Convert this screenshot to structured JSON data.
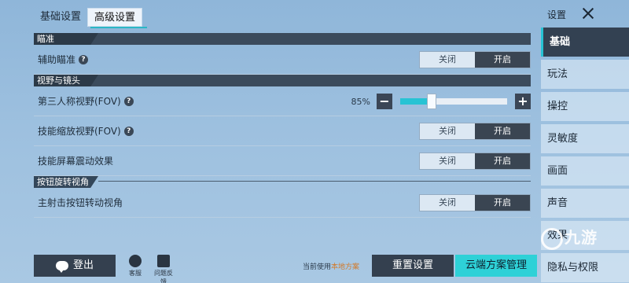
{
  "tabs": [
    {
      "label": "基础设置"
    },
    {
      "label": "高级设置"
    }
  ],
  "sections": {
    "aim": {
      "title": "瞄准"
    },
    "view": {
      "title": "视野与镜头"
    },
    "button_rotate": {
      "title": "按钮旋转视角"
    }
  },
  "rows": {
    "assist_aim": {
      "label": "辅助瞄准",
      "off": "关闭",
      "on": "开启"
    },
    "third_person_fov": {
      "label": "第三人称视野(FOV)",
      "percent": "85%",
      "value_fraction": 0.25
    },
    "skill_zoom_fov": {
      "label": "技能缩放视野(FOV)",
      "off": "关闭",
      "on": "开启"
    },
    "skill_shake": {
      "label": "技能屏幕震动效果",
      "off": "关闭",
      "on": "开启"
    },
    "fire_rotate": {
      "label": "主射击按钮转动视角",
      "off": "关闭",
      "on": "开启"
    }
  },
  "nav": {
    "title": "设置",
    "items": [
      {
        "label": "基础"
      },
      {
        "label": "玩法"
      },
      {
        "label": "操控"
      },
      {
        "label": "灵敏度"
      },
      {
        "label": "画面"
      },
      {
        "label": "声音"
      },
      {
        "label": "效果"
      },
      {
        "label": "隐私与权限"
      }
    ]
  },
  "bottom": {
    "logout": "登出",
    "service": "客服",
    "feedback": "问题反馈",
    "current_prefix": "当前使用",
    "current_plan": "本地方案",
    "reset": "重置设置",
    "cloud": "云端方案管理"
  },
  "watermark": "九游",
  "colors": {
    "accent": "#27c3d4",
    "dark": "#34404f",
    "plan_highlight": "#d27a2a"
  }
}
